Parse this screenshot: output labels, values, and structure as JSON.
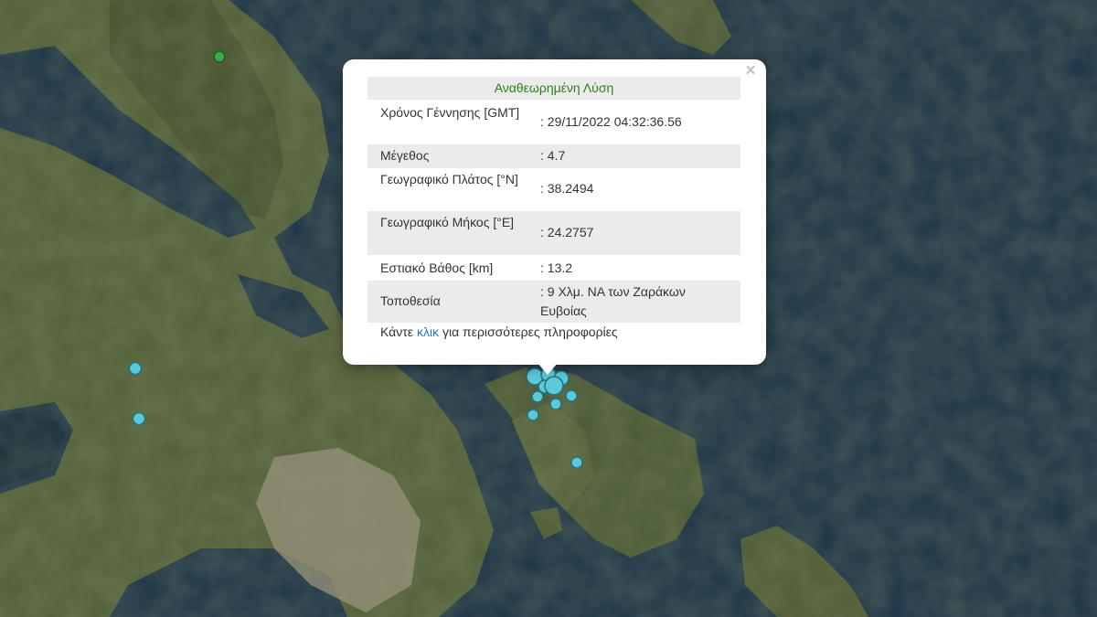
{
  "popup": {
    "title": "Αναθεωρημένη Λύση",
    "close_glyph": "×",
    "rows": [
      {
        "label": "Χρόνος Γέννησης [GMT]",
        "value": ": 29/11/2022 04:32:36.56"
      },
      {
        "label": "Μέγεθος",
        "value": ": 4.7"
      },
      {
        "label": "Γεωγραφικό Πλάτος [°N]",
        "value": ": 38.2494"
      },
      {
        "label": "Γεωγραφικό Μήκος [°E]",
        "value": ": 24.2757"
      },
      {
        "label": "Εστιακό Βάθος [km]",
        "value": ": 13.2"
      },
      {
        "label": "Τοποθεσία",
        "value": ": 9 Χλμ. ΝΑ των Ζαράκων Ευβοίας"
      }
    ],
    "footer_pre": "Κάντε",
    "footer_link": "κλικ",
    "footer_post": "για περισσότερες πληροφορίες"
  },
  "colors": {
    "sea": "#1c3346",
    "land": "#4f5a36",
    "marker_fill": "#5cc8d8",
    "marker_stroke": "#23707d",
    "green_marker": "#3aa84a",
    "title_green": "#2e7d1e",
    "link_blue": "#2a7ab5"
  }
}
